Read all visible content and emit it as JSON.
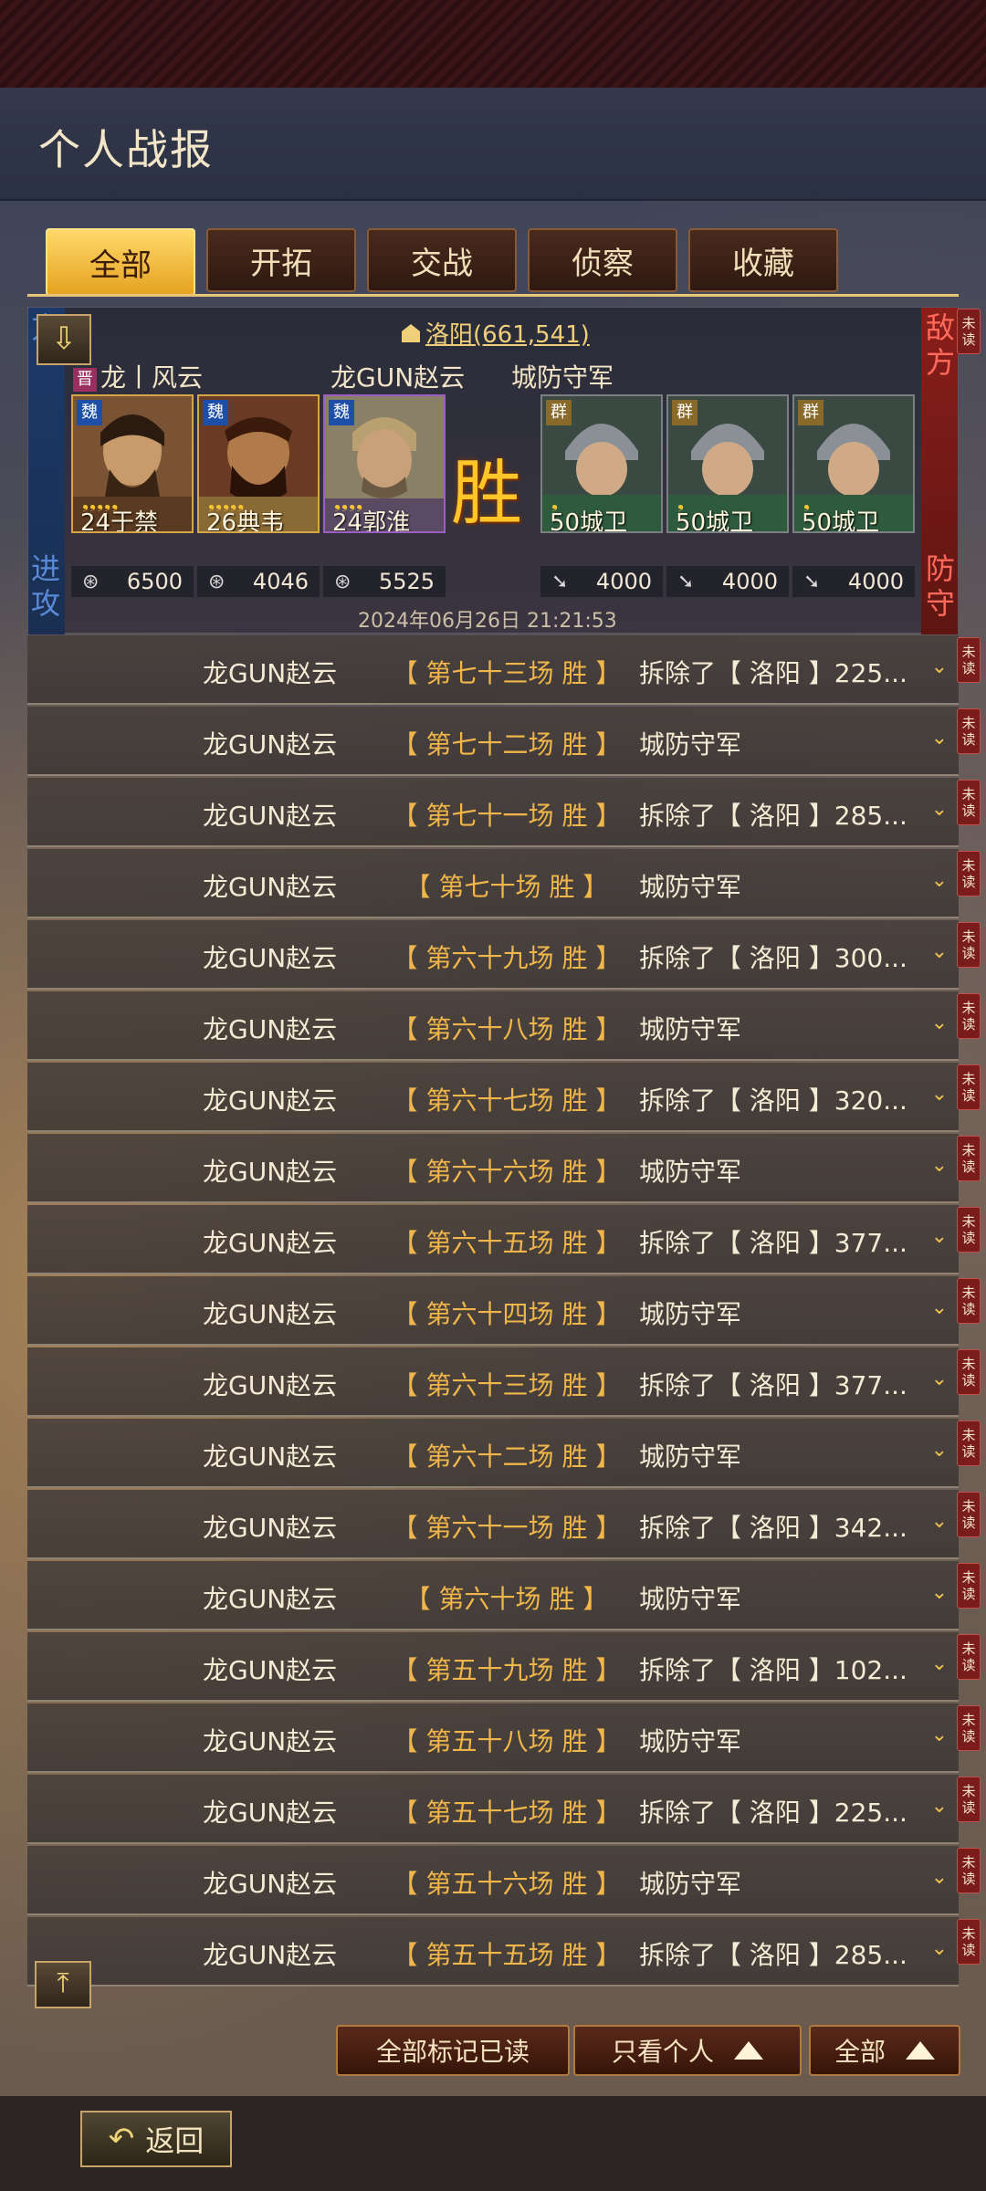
{
  "page_title": "个人战报",
  "tabs": [
    {
      "label": "全部",
      "active": true
    },
    {
      "label": "开拓",
      "active": false
    },
    {
      "label": "交战",
      "active": false
    },
    {
      "label": "侦察",
      "active": false
    },
    {
      "label": "收藏",
      "active": false
    }
  ],
  "unread_label": "未读",
  "card": {
    "attack_side": "进攻",
    "defense_side": "防守",
    "enemy_side": "敌方",
    "own_side_partial": "方",
    "location": "洛阳(661,541)",
    "attacker_faction": "晋",
    "attacker_name": "龙丨风云",
    "attacker_player": "龙GUN赵云",
    "defender_name": "城防守军",
    "result": "胜",
    "timestamp": "2024年06月26日 21:21:53",
    "attack_generals": [
      {
        "faction": "魏",
        "stars": "❟❟❟❟❟",
        "name": "24于禁",
        "troops": "6500"
      },
      {
        "faction": "魏",
        "stars": "❟❟❟❟❟",
        "name": "26典韦",
        "troops": "4046"
      },
      {
        "faction": "魏",
        "stars": "❟❟❟❟",
        "name": "24郭淮",
        "troops": "5525"
      }
    ],
    "defense_generals": [
      {
        "faction": "群",
        "stars": "❟",
        "name": "50城卫",
        "troops": "4000"
      },
      {
        "faction": "群",
        "stars": "❟",
        "name": "50城卫",
        "troops": "4000"
      },
      {
        "faction": "群",
        "stars": "❟",
        "name": "50城卫",
        "troops": "4000"
      }
    ]
  },
  "reports": [
    {
      "attacker": "龙GUN赵云",
      "round": "【 第七十三场 胜 】",
      "result": "拆除了【 洛阳 】225..."
    },
    {
      "attacker": "龙GUN赵云",
      "round": "【 第七十二场 胜 】",
      "result": "城防守军"
    },
    {
      "attacker": "龙GUN赵云",
      "round": "【 第七十一场 胜 】",
      "result": "拆除了【 洛阳 】285..."
    },
    {
      "attacker": "龙GUN赵云",
      "round": "【 第七十场 胜 】",
      "result": "城防守军"
    },
    {
      "attacker": "龙GUN赵云",
      "round": "【 第六十九场 胜 】",
      "result": "拆除了【 洛阳 】300..."
    },
    {
      "attacker": "龙GUN赵云",
      "round": "【 第六十八场 胜 】",
      "result": "城防守军"
    },
    {
      "attacker": "龙GUN赵云",
      "round": "【 第六十七场 胜 】",
      "result": "拆除了【 洛阳 】320..."
    },
    {
      "attacker": "龙GUN赵云",
      "round": "【 第六十六场 胜 】",
      "result": "城防守军"
    },
    {
      "attacker": "龙GUN赵云",
      "round": "【 第六十五场 胜 】",
      "result": "拆除了【 洛阳 】377..."
    },
    {
      "attacker": "龙GUN赵云",
      "round": "【 第六十四场 胜 】",
      "result": "城防守军"
    },
    {
      "attacker": "龙GUN赵云",
      "round": "【 第六十三场 胜 】",
      "result": "拆除了【 洛阳 】377..."
    },
    {
      "attacker": "龙GUN赵云",
      "round": "【 第六十二场 胜 】",
      "result": "城防守军"
    },
    {
      "attacker": "龙GUN赵云",
      "round": "【 第六十一场 胜 】",
      "result": "拆除了【 洛阳 】342..."
    },
    {
      "attacker": "龙GUN赵云",
      "round": "【 第六十场 胜 】",
      "result": "城防守军"
    },
    {
      "attacker": "龙GUN赵云",
      "round": "【 第五十九场 胜 】",
      "result": "拆除了【 洛阳 】102..."
    },
    {
      "attacker": "龙GUN赵云",
      "round": "【 第五十八场 胜 】",
      "result": "城防守军"
    },
    {
      "attacker": "龙GUN赵云",
      "round": "【 第五十七场 胜 】",
      "result": "拆除了【 洛阳 】225..."
    },
    {
      "attacker": "龙GUN赵云",
      "round": "【 第五十六场 胜 】",
      "result": "城防守军"
    },
    {
      "attacker": "龙GUN赵云",
      "round": "【 第五十五场 胜 】",
      "result": "拆除了【 洛阳 】285..."
    }
  ],
  "actions": {
    "mark_all_read": "全部标记已读",
    "only_personal": "只看个人",
    "filter_all": "全部"
  },
  "back_label": "返回",
  "colors": {
    "accent_gold": "#f0b64a",
    "tab_active": "#e6a321",
    "attack_blue": "#1b3a6b",
    "defense_red": "#8a1e1a"
  }
}
